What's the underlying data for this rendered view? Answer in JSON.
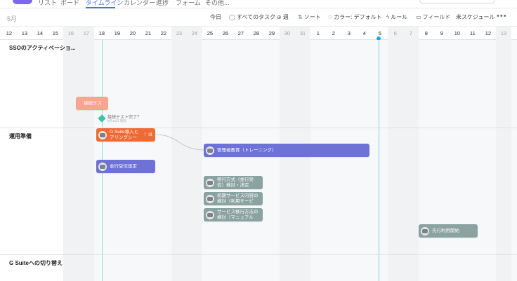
{
  "tabs": [
    {
      "label": "リスト",
      "active": false
    },
    {
      "label": "ボード",
      "active": false
    },
    {
      "label": "タイムライン",
      "active": true
    },
    {
      "label": "カレンダー",
      "active": false
    },
    {
      "label": "進捗",
      "active": false
    },
    {
      "label": "フォーム",
      "active": false
    },
    {
      "label": "その他...",
      "active": false
    }
  ],
  "toolbar": {
    "month": "5月",
    "today": "今日",
    "all_tasks": "すべてのタスク",
    "week": "週",
    "sort": "ソート",
    "color": "カラー: デフォルト",
    "rules": "ルール",
    "fields": "フィールド",
    "unscheduled": "未スケジュール",
    "more": "•••"
  },
  "days": [
    "12",
    "13",
    "14",
    "15",
    "16",
    "17",
    "18",
    "19",
    "20",
    "21",
    "22",
    "23",
    "24",
    "25",
    "26",
    "27",
    "28",
    "29",
    "30",
    "31",
    "1",
    "2",
    "3",
    "4",
    "5",
    "6",
    "7",
    "8",
    "9",
    "10",
    "11",
    "12",
    "13"
  ],
  "sections": [
    {
      "title": "SSOのアクティベーショ..."
    },
    {
      "title": "運用準備"
    },
    {
      "title": "G Suiteへの切り替え"
    }
  ],
  "tasks": {
    "salmon": "接続テス",
    "milestone": "接続テスト完了？",
    "milestone_sub": "5月18日 期限",
    "gsuite_hearing": "G Suite導入ヒアリングシート...",
    "gsuite_hearing_badge": "！は",
    "admin_training": "管理者教育（トレーニング）",
    "pilot_setup": "並行受信設定",
    "migration_method": "移行方式（並行受信）検討・決定",
    "initial_service": "初期サービス内容の検討（利用サービス...",
    "service_migration": "サービス移行方法の検討（マニュアルの...",
    "pilot_start": "先行利用開始"
  },
  "colors": {
    "accent": "#4573d2",
    "purple_task": "#6e72d6",
    "gray_task": "#8aa2a0",
    "orange_task": "#f06a35",
    "salmon_task": "#f8a58f",
    "milestone": "#37c5ab",
    "today_marker": "#14aaf5"
  }
}
